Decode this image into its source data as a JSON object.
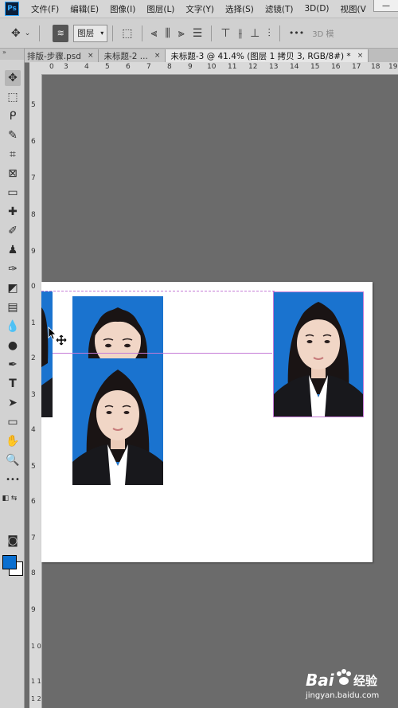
{
  "app": {
    "logo": "Ps"
  },
  "menubar": {
    "items": [
      "文件(F)",
      "编辑(E)",
      "图像(I)",
      "图层(L)",
      "文字(Y)",
      "选择(S)",
      "滤镜(T)",
      "3D(D)",
      "视图(V"
    ]
  },
  "options_bar": {
    "layer_select": "图层",
    "more": "•••",
    "threed_label": "3D 模"
  },
  "tabs": [
    {
      "label": "排版-步骤.psd",
      "close": "×"
    },
    {
      "label": "未标题-2 ...",
      "close": "×"
    },
    {
      "label": "未标题-3 @ 41.4% (图层 1 拷贝 3, RGB/8#) *",
      "close": "×"
    }
  ],
  "rulers": {
    "top": [
      "0",
      "3",
      "4",
      "5",
      "6",
      "7",
      "8",
      "9",
      "10",
      "11",
      "12",
      "13",
      "14",
      "15",
      "16",
      "17",
      "18",
      "19"
    ],
    "left": [
      "5",
      "6",
      "7",
      "8",
      "9",
      "0",
      "1",
      "2",
      "3",
      "4",
      "5",
      "6",
      "7",
      "8",
      "9",
      "1 0",
      "1 1",
      "1 2"
    ]
  },
  "toolbar": {
    "tools": [
      "move-tool",
      "marquee-tool",
      "lasso-tool",
      "quick-selection-tool",
      "crop-tool",
      "frame-tool",
      "eyedropper-tool",
      "healing-brush-tool",
      "brush-tool",
      "clone-stamp-tool",
      "history-brush-tool",
      "eraser-tool",
      "gradient-tool",
      "blur-tool",
      "dodge-tool",
      "pen-tool",
      "type-tool",
      "path-selection-tool",
      "rectangle-tool",
      "hand-tool",
      "zoom-tool",
      "edit-toolbar"
    ],
    "type_glyph": "T",
    "more_glyph": "•••"
  },
  "colors": {
    "foreground": "#0a6fd0",
    "background": "#ffffff",
    "photo_bg": "#1a73cf",
    "guide": "#c47ad6"
  },
  "watermark": {
    "brand": "Bai",
    "brand_suffix": "经验",
    "url": "jingyan.baidu.com"
  }
}
